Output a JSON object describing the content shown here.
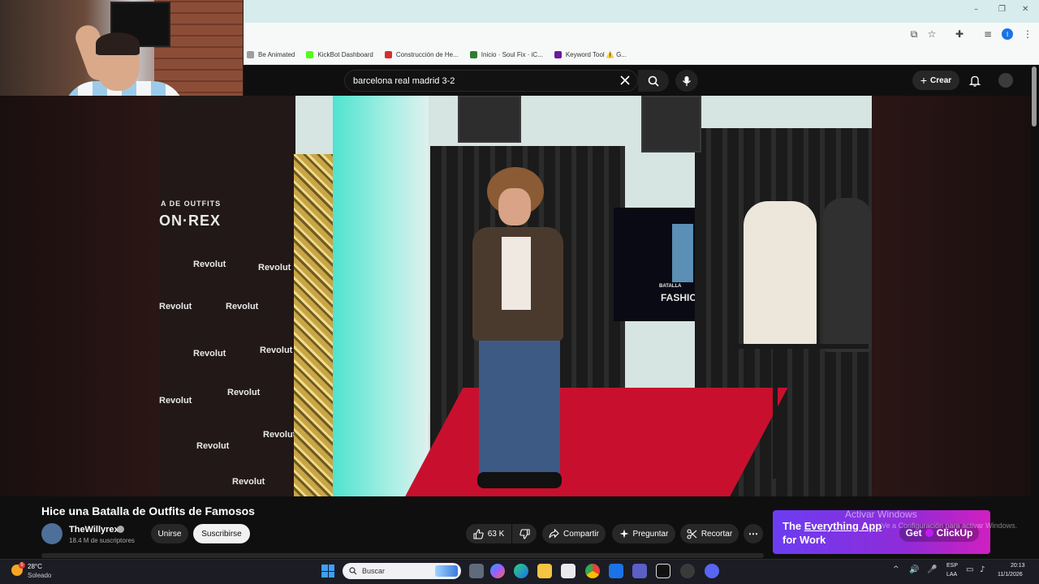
{
  "browser": {
    "bookmarks": [
      {
        "label": "Be Animated",
        "color": "#9e9e9e"
      },
      {
        "label": "KickBot Dashboard",
        "color": "#53fc18"
      },
      {
        "label": "Construcción de He...",
        "color": "#d32f2f"
      },
      {
        "label": "Inicio · Soul Fix · iC...",
        "color": "#2e7d32"
      },
      {
        "label": "Keyword Tool ⚠️ G...",
        "color": "#6a1b9a"
      }
    ],
    "window_controls": [
      "–",
      "❐",
      "✕"
    ],
    "profile_initial": "I"
  },
  "youtube": {
    "search": {
      "value": "barcelona real madrid 3-2"
    },
    "create_label": "Crear",
    "video": {
      "title": "Hice una Batalla de Outfits de Famosos",
      "channel": "TheWillyrex",
      "subscribers": "18.4 M de suscriptores",
      "join_label": "Unirse",
      "subscribe_label": "Suscribirse",
      "likes": "63 K",
      "share_label": "Compartir",
      "ask_label": "Preguntar",
      "clip_label": "Recortar",
      "video_texts": {
        "banner_small": "A DE OUTFITS",
        "banner_big": "ON·REX",
        "sponsor": "Revolut",
        "screen_text": "FASHIO",
        "screen_small": "BATALLA"
      }
    },
    "ad": {
      "line1_a": "The ",
      "line1_b": "Everything App",
      "line2": "for Work",
      "cta": "Get",
      "brand": "ClickUp"
    }
  },
  "windows_overlay": {
    "title": "Activar Windows",
    "subtitle": "Ve a Configuración para activar Windows."
  },
  "taskbar": {
    "weather_temp": "28°C",
    "weather_desc": "Soleado",
    "weather_badge": "5",
    "search_placeholder": "Buscar",
    "lang_line1": "ESP",
    "lang_line2": "LAA",
    "time": "20:13",
    "date": "11/1/2026"
  }
}
